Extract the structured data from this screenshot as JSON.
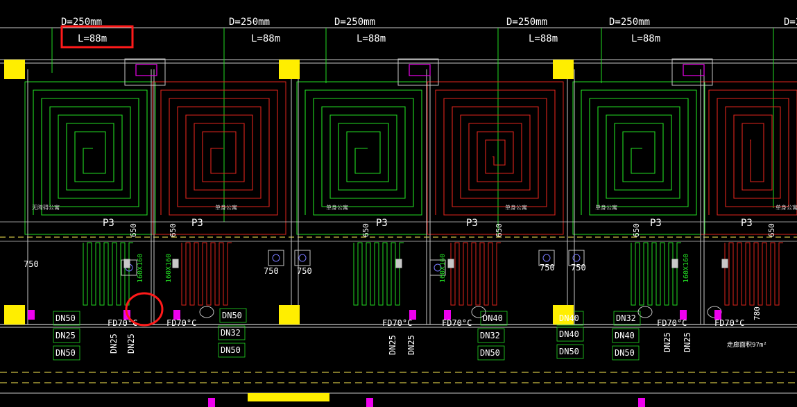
{
  "colors": {
    "background": "#000000",
    "green_coil": "#22dd22",
    "red_coil": "#e0241c",
    "frame": "#c8c8c8",
    "yellow": "#ffee00",
    "magenta": "#ee00ee",
    "dashed": "#ffee55",
    "highlight": "#ff1a1a",
    "text": "#ffffff"
  },
  "header": {
    "diameter": "D=250mm",
    "length": "L=88m"
  },
  "room_labels": {
    "barrier_free_apartment": "无障碍公寓",
    "single_apartment": "单身公寓",
    "corridor_area": "走廊面积97m²"
  },
  "dimensions": {
    "d650": "650",
    "d750": "750",
    "d780": "780",
    "duct": "160X160"
  },
  "tags": {
    "p3": "P3",
    "fd70": "FD70°C"
  },
  "pipe_sizes": {
    "dn25": "DN25",
    "dn32": "DN32",
    "dn40": "DN40",
    "dn50": "DN50"
  }
}
